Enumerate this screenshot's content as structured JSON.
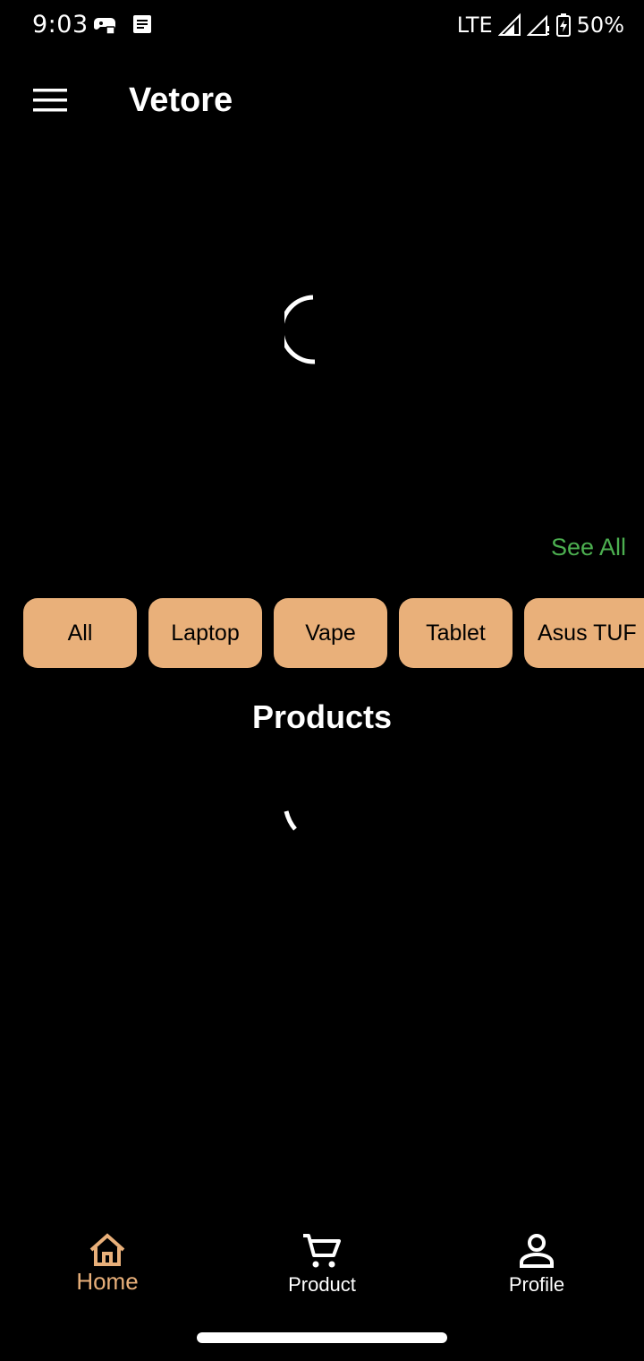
{
  "status_bar": {
    "time": "9:03",
    "network": "LTE",
    "battery": "50%",
    "icons": [
      "game-controller-icon",
      "notes-icon",
      "signal-icon",
      "signal-weak-icon",
      "battery-charging-icon"
    ]
  },
  "app_bar": {
    "title": "Vetore",
    "menu_icon": "hamburger-menu-icon"
  },
  "section": {
    "see_all": "See All",
    "products_title": "Products"
  },
  "categories": [
    "All",
    "Laptop",
    "Vape",
    "Tablet",
    "Asus TUF"
  ],
  "bottom_nav": {
    "items": [
      {
        "label": "Home",
        "icon": "home-icon",
        "active": true
      },
      {
        "label": "Product",
        "icon": "cart-icon",
        "active": false
      },
      {
        "label": "Profile",
        "icon": "person-icon",
        "active": false
      }
    ]
  },
  "colors": {
    "background": "#000000",
    "accent": "#e9b07a",
    "link": "#4caf50",
    "text": "#ffffff"
  }
}
